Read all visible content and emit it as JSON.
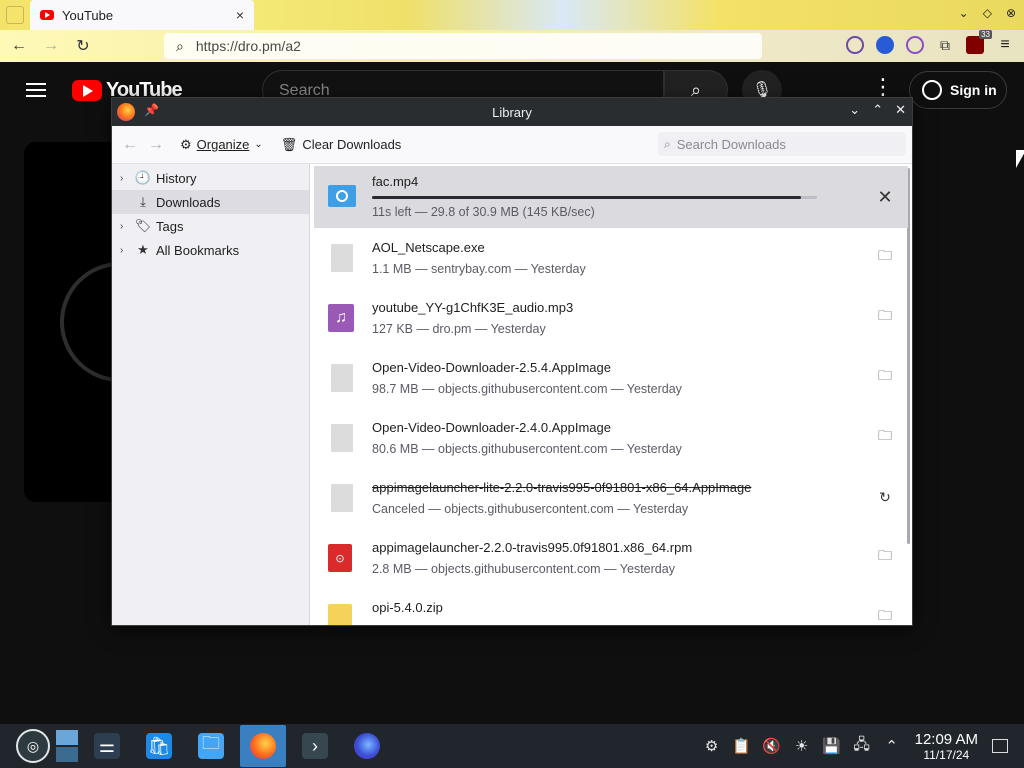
{
  "browser": {
    "tab": {
      "title": "YouTube",
      "close": "×"
    },
    "url": "https://dro.pm/a2",
    "ublock_count": "33",
    "icons": {
      "back": "arrow-left-icon",
      "forward": "arrow-right-icon",
      "reload": "reload-icon",
      "search": "search-icon",
      "menu": "hamburger-menu-icon"
    }
  },
  "youtube": {
    "logo_text": "YouTube",
    "search_placeholder": "Search",
    "signin_label": "Sign in",
    "more": "⋮"
  },
  "library": {
    "title": "Library",
    "toolbar": {
      "organize": "Organize",
      "clear_downloads": "Clear Downloads",
      "search_placeholder": "Search Downloads"
    },
    "sidebar": [
      {
        "label": "History",
        "icon": "clock-icon",
        "expandable": true,
        "selected": false
      },
      {
        "label": "Downloads",
        "icon": "download-icon",
        "expandable": false,
        "selected": true
      },
      {
        "label": "Tags",
        "icon": "tag-icon",
        "expandable": true,
        "selected": false
      },
      {
        "label": "All Bookmarks",
        "icon": "star-icon",
        "expandable": true,
        "selected": false
      }
    ],
    "downloads": [
      {
        "name": "fac.mp4",
        "status": "11s left — 29.8 of 30.9 MB (145 KB/sec)",
        "icon": "video-file-icon",
        "action": "cancel-icon",
        "progress": 0.964,
        "active": true,
        "canceled": false
      },
      {
        "name": "AOL_Netscape.exe",
        "status": "1.1 MB — sentrybay.com — Yesterday",
        "icon": "generic-file-icon",
        "action": "folder-icon",
        "active": false,
        "canceled": false
      },
      {
        "name": "youtube_YY-g1ChfK3E_audio.mp3",
        "status": "127 KB — dro.pm — Yesterday",
        "icon": "audio-file-icon",
        "action": "folder-icon",
        "active": false,
        "canceled": false
      },
      {
        "name": "Open-Video-Downloader-2.5.4.AppImage",
        "status": "98.7 MB — objects.githubusercontent.com — Yesterday",
        "icon": "generic-file-icon",
        "action": "folder-icon",
        "active": false,
        "canceled": false
      },
      {
        "name": "Open-Video-Downloader-2.4.0.AppImage",
        "status": "80.6 MB — objects.githubusercontent.com — Yesterday",
        "icon": "generic-file-icon",
        "action": "folder-icon",
        "active": false,
        "canceled": false
      },
      {
        "name": "appimagelauncher-lite-2.2.0-travis995-0f91801-x86_64.AppImage",
        "status": "Canceled — objects.githubusercontent.com — Yesterday",
        "icon": "generic-file-icon",
        "action": "retry-icon",
        "active": false,
        "canceled": true
      },
      {
        "name": "appimagelauncher-2.2.0-travis995.0f91801.x86_64.rpm",
        "status": "2.8 MB — objects.githubusercontent.com — Yesterday",
        "icon": "rpm-package-icon",
        "action": "folder-icon",
        "active": false,
        "canceled": false
      },
      {
        "name": "opi-5.4.0.zip",
        "status": "",
        "icon": "zip-file-icon",
        "action": "folder-icon",
        "active": false,
        "canceled": false
      }
    ]
  },
  "taskbar": {
    "time": "12:09 AM",
    "date": "11/17/24",
    "apps": [
      "settings-icon",
      "store-icon",
      "file-manager-icon",
      "firefox-icon",
      "terminal-icon",
      "firefox-nightly-icon"
    ]
  },
  "colors": {
    "accent": "#3a7fbf",
    "youtube_red": "#ff0000",
    "title_bar": "#2a2d30",
    "taskbar": "#20262b"
  }
}
